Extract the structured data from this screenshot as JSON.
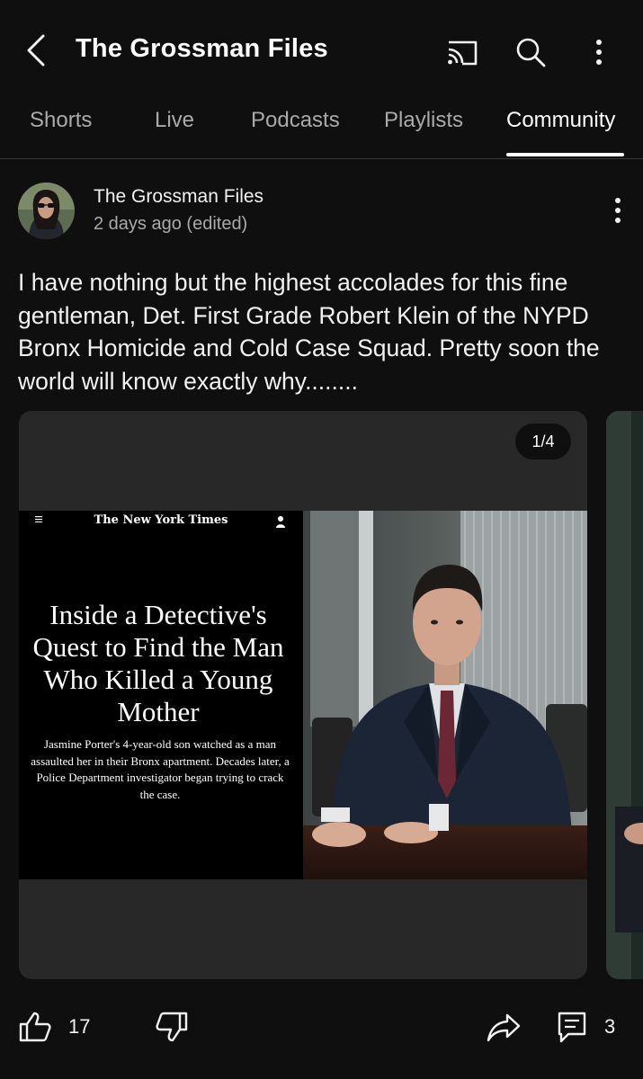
{
  "header": {
    "title": "The Grossman Files",
    "icons": [
      "back-arrow-icon",
      "cast-icon",
      "search-icon",
      "more-vertical-icon"
    ]
  },
  "tabs": [
    {
      "label": "Shorts",
      "active": false
    },
    {
      "label": "Live",
      "active": false
    },
    {
      "label": "Podcasts",
      "active": false
    },
    {
      "label": "Playlists",
      "active": false
    },
    {
      "label": "Community",
      "active": true
    }
  ],
  "post": {
    "author": "The Grossman Files",
    "time": "2 days ago (edited)",
    "text": "I have nothing but the highest accolades for this fine gentleman, Det. First Grade Robert Klein of the NYPD Bronx Homicide and Cold Case Squad. Pretty soon the world will know exactly why........",
    "carousel": {
      "page_indicator": "1/4",
      "article": {
        "publication": "The New York Times",
        "headline": "Inside a Detective's Quest to Find the Man Who Killed a Young Mother",
        "summary": "Jasmine Porter's 4-year-old son watched as a man assaulted her in their Bronx apartment. Decades later, a Police Department investigator began trying to crack the case."
      }
    },
    "actions": {
      "likes": "17",
      "comments": "3"
    }
  },
  "colors": {
    "background": "#0f0f0f",
    "text_primary": "#f1f1f1",
    "text_secondary": "#aaaaaa",
    "card": "#282828"
  }
}
